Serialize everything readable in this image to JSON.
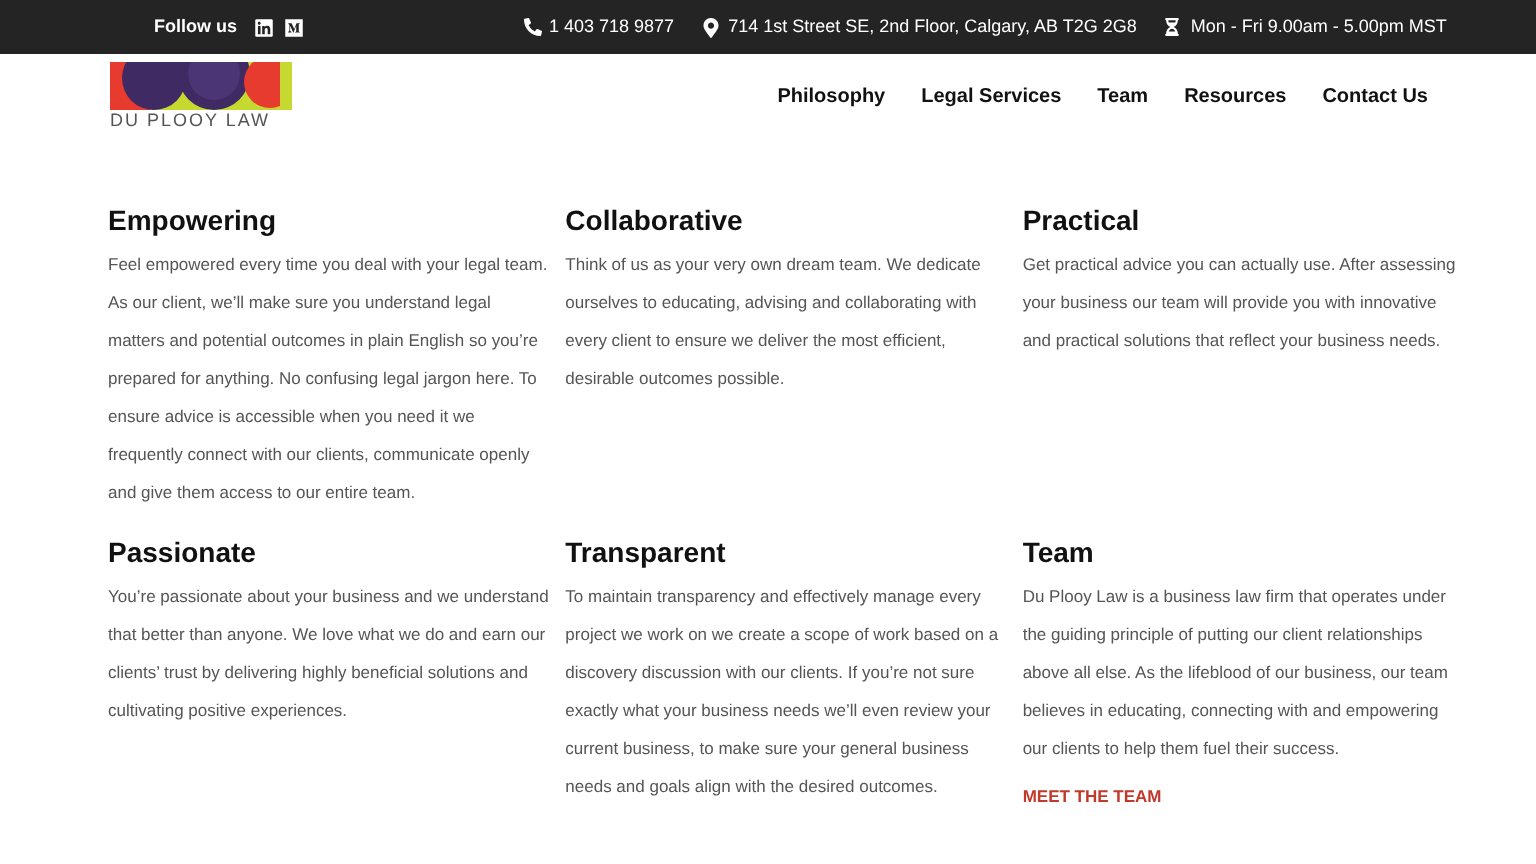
{
  "top_bar": {
    "follow_label": "Follow us",
    "phone": "1 403 718 9877",
    "address": "714 1st Street SE, 2nd Floor, Calgary, AB T2G 2G8",
    "hours": "Mon - Fri 9.00am - 5.00pm MST"
  },
  "logo": {
    "text": "DU PLOOY LAW"
  },
  "nav": [
    "Philosophy",
    "Legal Services",
    "Team",
    "Resources",
    "Contact Us"
  ],
  "sections": [
    {
      "title": "Empowering",
      "body": "Feel empowered every time you deal with your legal team. As our client, we’ll make sure you understand legal matters and potential outcomes in plain English so you’re prepared for anything. No confusing legal jargon here. To ensure advice is accessible when you need it we frequently connect with our clients, communicate openly and give them access to our entire team."
    },
    {
      "title": "Collaborative",
      "body": "Think of us as your very own dream team. We dedicate ourselves to educating, advising and collaborating with every client to ensure we deliver the most efficient, desirable outcomes possible."
    },
    {
      "title": "Practical",
      "body": "Get practical advice you can actually use. After assessing your business our team will provide you with innovative and practical solutions that reflect your business needs."
    },
    {
      "title": "Passionate",
      "body": "You’re passionate about your business and we understand that better than anyone. We love what we do and earn our clients’ trust by delivering highly beneficial solutions and cultivating positive experiences."
    },
    {
      "title": "Transparent",
      "body": "To maintain transparency and effectively manage every project we work on we create a scope of work based on a discovery discussion with our clients. If you’re not sure exactly what your business needs we’ll even review your current business, to make sure your general business needs and goals align with the desired outcomes."
    },
    {
      "title": "Team",
      "body": "Du Plooy Law is a business law firm that operates under the guiding principle of putting our client relationships above all else. As the lifeblood of our business, our team believes in educating, connecting with and empowering our clients to help them fuel their success.",
      "link": "MEET THE TEAM"
    }
  ]
}
